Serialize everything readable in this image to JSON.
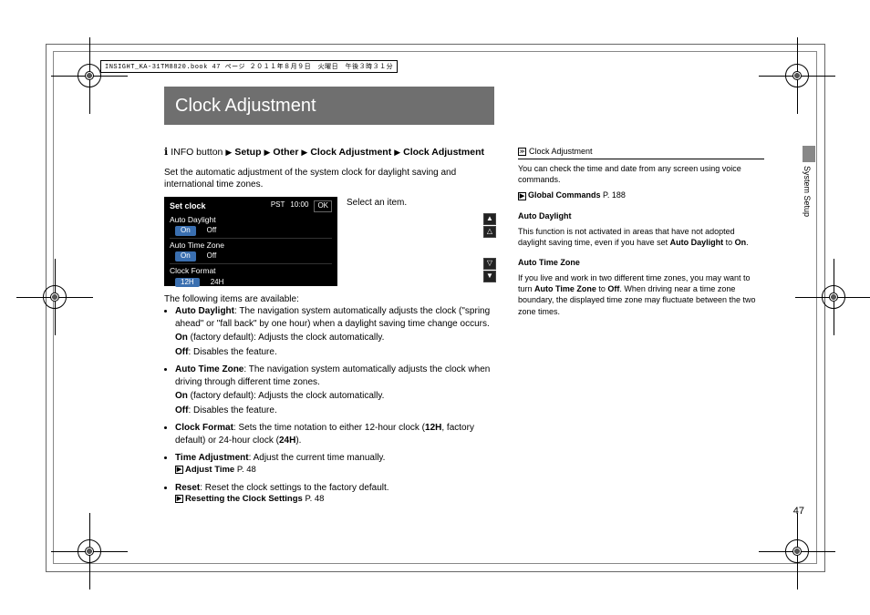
{
  "book_header": "INSIGHT_KA-31TM8820.book  47 ページ  ２０１１年８月９日　火曜日　午後３時３１分",
  "title": "Clock Adjustment",
  "breadcrumb": {
    "prefix": "INFO button",
    "items": [
      "Setup",
      "Other",
      "Clock Adjustment",
      "Clock Adjustment"
    ]
  },
  "intro": "Set the automatic adjustment of the system clock for daylight saving and international time zones.",
  "screenshot": {
    "header": "Set clock",
    "tz": "PST",
    "time": "10:00",
    "ok": "OK",
    "rows": [
      {
        "title": "Auto Daylight",
        "opts": [
          "On",
          "Off"
        ]
      },
      {
        "title": "Auto Time Zone",
        "opts": [
          "On",
          "Off"
        ]
      },
      {
        "title": "Clock Format",
        "opts": [
          "12H",
          "24H"
        ]
      }
    ]
  },
  "select_item": "Select an item.",
  "following": "The following items are available:",
  "items": [
    {
      "name": "Auto Daylight",
      "desc": ": The navigation system automatically adjusts the clock (\"spring ahead\" or \"fall back\" by one hour) when a daylight saving time change occurs.",
      "on": "On",
      "on_desc": " (factory default): Adjusts the clock automatically.",
      "off": "Off",
      "off_desc": ": Disables the feature."
    },
    {
      "name": "Auto Time Zone",
      "desc": ": The navigation system automatically adjusts the clock when driving through different time zones.",
      "on": "On",
      "on_desc": " (factory default): Adjusts the clock automatically.",
      "off": "Off",
      "off_desc": ": Disables the feature."
    },
    {
      "name": "Clock Format",
      "desc": ": Sets the time notation to either 12-hour clock (",
      "mid1": "12H",
      "desc2": ", factory default) or 24-hour clock (",
      "mid2": "24H",
      "desc3": ")."
    },
    {
      "name": "Time Adjustment",
      "desc": ": Adjust the current time manually.",
      "ref": "Adjust Time",
      "page": "P. 48"
    },
    {
      "name": "Reset",
      "desc": ": Reset the clock settings to the factory default.",
      "ref": "Resetting the Clock Settings",
      "page": "P. 48"
    }
  ],
  "side": {
    "head": "Clock Adjustment",
    "p1": "You can check the time and date from any screen using voice commands.",
    "ref1": "Global Commands",
    "ref1_page": "P. 188",
    "h1": "Auto Daylight",
    "p2a": "This function is not activated in areas that have not adopted daylight saving time, even if you have set ",
    "p2b": "Auto Daylight",
    "p2c": " to ",
    "p2d": "On",
    "p2e": ".",
    "h2": "Auto Time Zone",
    "p3a": "If you live and work in two different time zones, you may want to turn ",
    "p3b": "Auto Time Zone",
    "p3c": " to ",
    "p3d": "Off",
    "p3e": ". When driving near a time zone boundary, the displayed time zone may fluctuate between the two zone times."
  },
  "tab_label": "System Setup",
  "page_number": "47"
}
